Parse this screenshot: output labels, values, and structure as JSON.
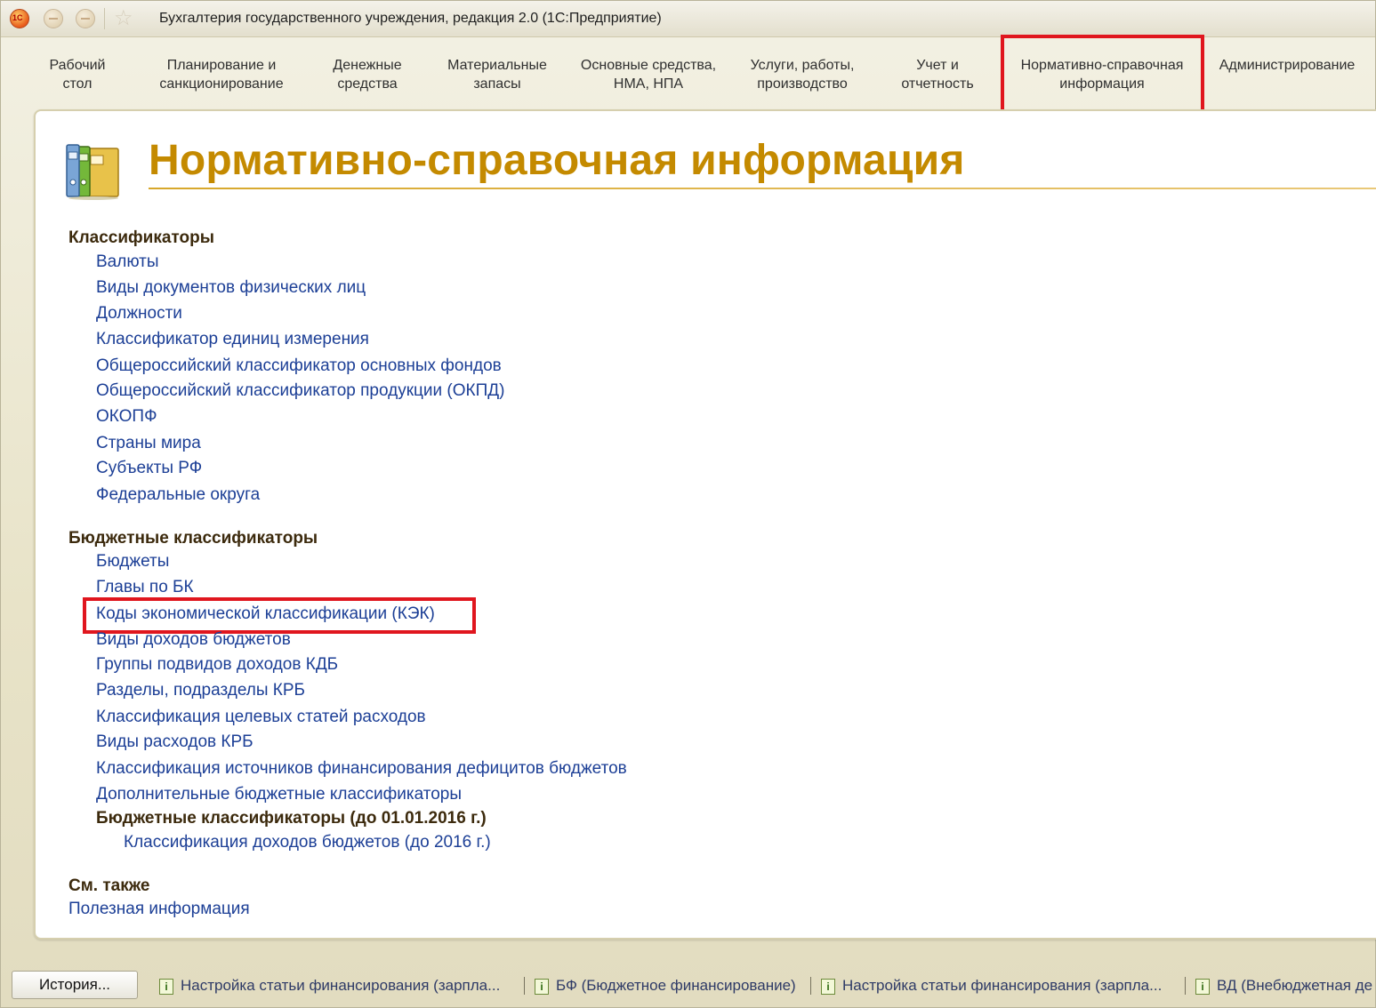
{
  "window": {
    "title": "Бухгалтерия государственного учреждения, редакция 2.0  (1С:Предприятие)",
    "logo_text": "1С"
  },
  "sections": [
    {
      "line1": "Рабочий",
      "line2": "стол"
    },
    {
      "line1": "Планирование и",
      "line2": "санкционирование"
    },
    {
      "line1": "Денежные",
      "line2": "средства"
    },
    {
      "line1": "Материальные",
      "line2": "запасы"
    },
    {
      "line1": "Основные средства,",
      "line2": "НМА, НПА"
    },
    {
      "line1": "Услуги, работы,",
      "line2": "производство"
    },
    {
      "line1": "Учет и",
      "line2": "отчетность"
    },
    {
      "line1": "Нормативно-справочная",
      "line2": "информация",
      "selected": true
    },
    {
      "line1": "Администрирование",
      "line2": ""
    }
  ],
  "page": {
    "title": "Нормативно-справочная информация",
    "icon": "binders-folder-icon",
    "accent_color": "#c48a00",
    "link_color": "#1c3f96",
    "highlight_color": "#e0161e"
  },
  "groups": {
    "classifiers": {
      "title": "Классификаторы",
      "links": [
        "Валюты",
        "Виды документов физических лиц",
        "Должности",
        "Классификатор единиц измерения",
        "Общероссийский классификатор основных фондов",
        "Общероссийский классификатор продукции (ОКПД)",
        "ОКОПФ",
        "Страны мира",
        "Субъекты РФ",
        "Федеральные округа"
      ]
    },
    "budget": {
      "title": "Бюджетные классификаторы",
      "links": [
        "Бюджеты",
        "Главы по БК",
        "Коды экономической классификации (КЭК)",
        "Виды доходов бюджетов",
        "Группы подвидов доходов КДБ",
        "Разделы, подразделы КРБ",
        "Классификация целевых статей расходов",
        "Виды расходов КРБ",
        "Классификация источников финансирования дефицитов бюджетов",
        "Дополнительные бюджетные классификаторы"
      ],
      "subgroup_title": "Бюджетные классификаторы (до 01.01.2016 г.)",
      "subgroup_links": [
        "Классификация доходов бюджетов (до 2016 г.)"
      ]
    },
    "see_also": {
      "title": "См. также",
      "links": [
        "Полезная информация"
      ]
    }
  },
  "taskbar": {
    "history_label": "История...",
    "items": [
      "Настройка статьи финансирования (зарпла...",
      "БФ (Бюджетное финансирование)",
      "Настройка статьи финансирования (зарпла...",
      "ВД (Внебюджетная де"
    ]
  }
}
